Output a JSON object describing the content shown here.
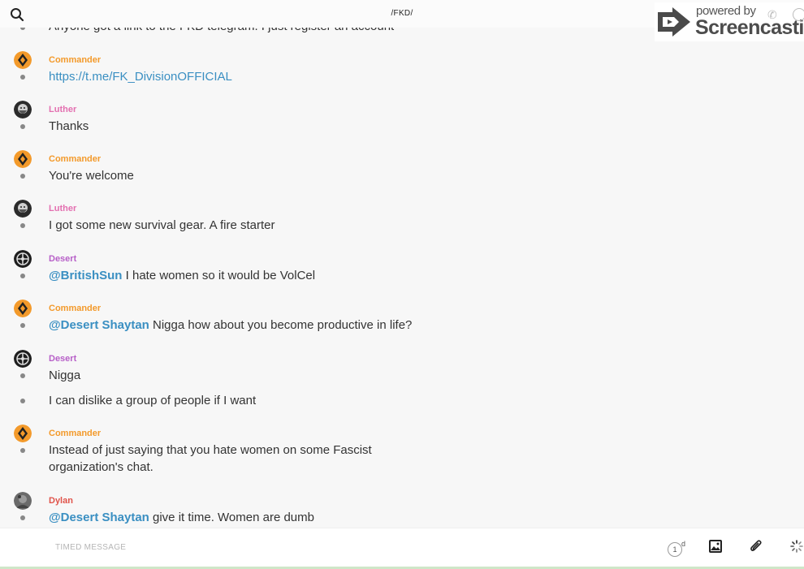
{
  "header": {
    "channel_title": "/FKD/"
  },
  "watermark": {
    "small_text": "powered by",
    "brand_text": "Screencastify"
  },
  "feed": {
    "cut_off_line": "Anyone got a link to the FKD telegram. I just register an account",
    "messages": [
      {
        "author": "Commander",
        "author_color": "#f39a2b",
        "avatar": "commander",
        "text": "https://t.me/FK_DivisionOFFICIAL",
        "is_link": true
      },
      {
        "author": "Luther",
        "author_color": "#e36fb0",
        "avatar": "luther",
        "text": "Thanks"
      },
      {
        "author": "Commander",
        "author_color": "#f39a2b",
        "avatar": "commander",
        "text": "You're welcome"
      },
      {
        "author": "Luther",
        "author_color": "#e36fb0",
        "avatar": "luther",
        "text": "I got some new survival gear. A fire starter"
      },
      {
        "author": "Desert",
        "author_color": "#b760c8",
        "avatar": "desert",
        "mention": "@BritishSun",
        "text": " I hate women so it would be VolCel"
      },
      {
        "author": "Commander",
        "author_color": "#f39a2b",
        "avatar": "commander",
        "mention": "@Desert Shaytan",
        "text": " Nigga how about you become productive in life?"
      },
      {
        "author": "Desert",
        "author_color": "#b760c8",
        "avatar": "desert",
        "text": "Nigga"
      },
      {
        "author": "",
        "text": "I can dislike a group of people if I want"
      },
      {
        "author": "Commander",
        "author_color": "#f39a2b",
        "avatar": "commander",
        "text": "Instead of just saying that you hate women on some Fascist organization's chat."
      },
      {
        "author": "Dylan",
        "author_color": "#e0534a",
        "avatar": "dylan",
        "mention": "@Desert Shaytan",
        "text": " give it time. Women are dumb"
      }
    ]
  },
  "composer": {
    "placeholder": "TIMED MESSAGE",
    "ttl_value": "1",
    "ttl_unit": "d"
  },
  "colors": {
    "mention": "#3a8fc2",
    "commander": "#f39a2b",
    "luther": "#e36fb0",
    "desert": "#b760c8",
    "dylan": "#e0534a"
  },
  "icons": [
    "search-icon",
    "screencastify-logo-icon",
    "phone-icon",
    "info-icon",
    "image-icon",
    "paperclip-icon",
    "loading-spinner-icon"
  ]
}
